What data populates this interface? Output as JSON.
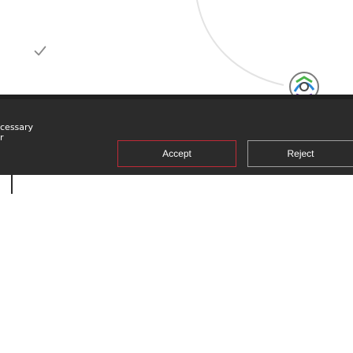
{
  "consent_bar": {
    "necessary_text": "cessary",
    "necessary_text_2": "r"
  },
  "buttons": {
    "accept_label": "Accept",
    "reject_label": "Reject"
  },
  "icons": {
    "check": "check-icon",
    "logo": "logo-icon"
  },
  "colors": {
    "bar_bg": "#2b2b2b",
    "accent_border": "#c02a37",
    "neutral_border": "#a0a0a0"
  }
}
